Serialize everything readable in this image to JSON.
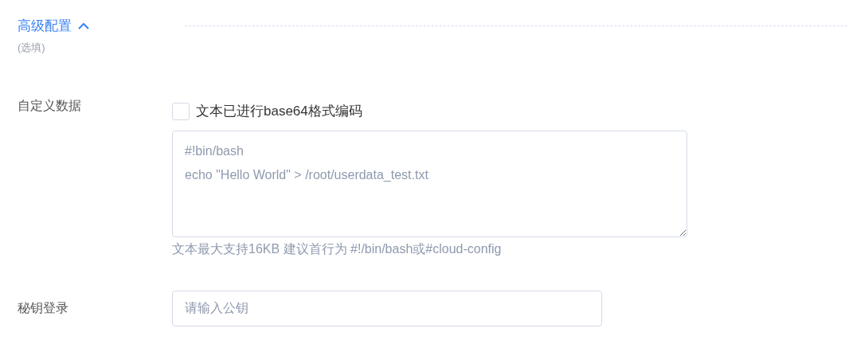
{
  "section": {
    "title": "高级配置",
    "expanded": true,
    "subtitle": "(选填)"
  },
  "user_data": {
    "label": "自定义数据",
    "base64_checkbox": {
      "label": "文本已进行base64格式编码",
      "checked": false
    },
    "placeholder": "#!bin/bash\necho \"Hello World\" > /root/userdata_test.txt",
    "hint": "文本最大支持16KB 建议首行为 #!/bin/bash或#cloud-config"
  },
  "key_login": {
    "label": "秘钥登录",
    "placeholder": "请输入公钥"
  }
}
